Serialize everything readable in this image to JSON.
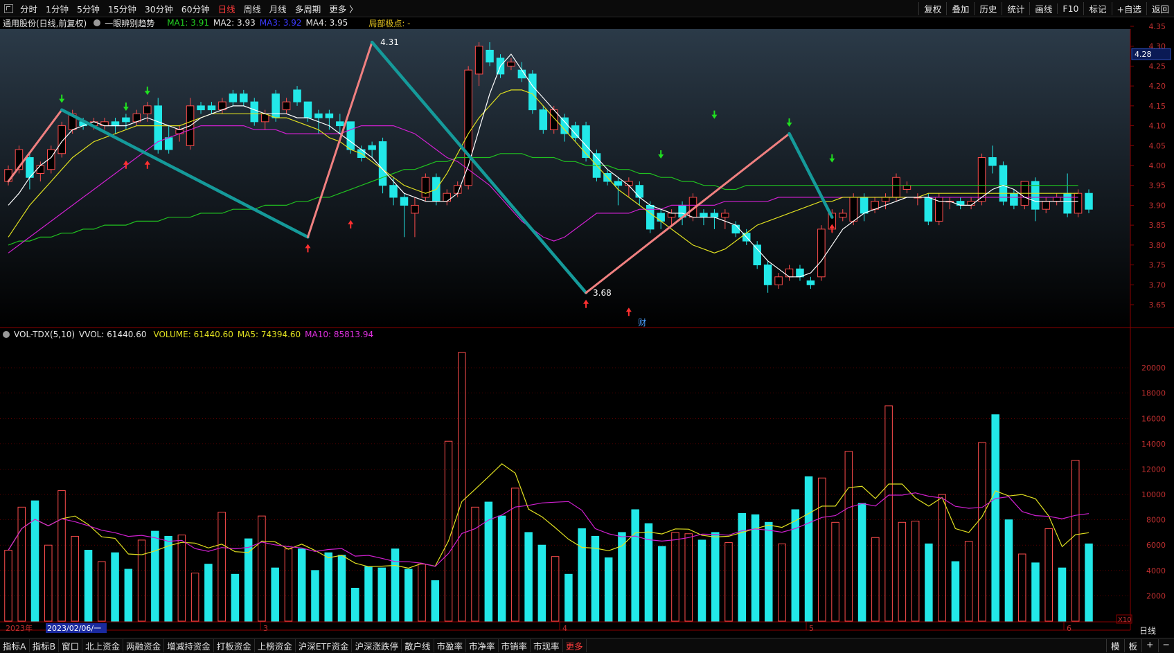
{
  "toolbar": {
    "periods": [
      "分时",
      "1分钟",
      "5分钟",
      "15分钟",
      "30分钟",
      "60分钟",
      "日线",
      "周线",
      "月线",
      "多周期",
      "更多 〉"
    ],
    "active_period": "日线",
    "right_tools": [
      "复权",
      "叠加",
      "历史",
      "统计",
      "画线",
      "F10",
      "标记",
      "+自选",
      "返回"
    ]
  },
  "info": {
    "title": "通用股份(日线,前复权)",
    "indicator": "一眼辨别趋势",
    "ma1": "MA1: 3.91",
    "ma2": "MA2: 3.93",
    "ma3": "MA3: 3.92",
    "ma4": "MA4: 3.95",
    "pivot": "局部极点: -"
  },
  "vol_info": {
    "name": "VOL-TDX(5,10)",
    "vvol": "VVOL: 61440.60",
    "volume": "VOLUME: 61440.60",
    "ma5": "MA5: 74394.60",
    "ma10": "MA10: 85813.94"
  },
  "bottom": {
    "tabs": [
      "指标A",
      "指标B",
      "窗口",
      "北上资金",
      "两融资金",
      "增减持资金",
      "打板资金",
      "上榜资金",
      "沪深ETF资金",
      "沪深涨跌停",
      "散户线",
      "市盈率",
      "市净率",
      "市销率",
      "市现率",
      "更多"
    ],
    "right": [
      "模",
      "板",
      "+",
      "−"
    ],
    "period_label": "日线"
  },
  "colors": {
    "up": "#ff4d4d",
    "down": "#22e8e8",
    "ma1": "#ffffff",
    "ma2": "#e0e020",
    "ma3": "#d020d0",
    "ma4": "#20c020",
    "zig_up": "#f08080",
    "zig_down": "#159a9a",
    "grid": "#8b0000"
  },
  "chart_data": {
    "type": "candlestick",
    "price_axis": {
      "ticks": [
        "4.35",
        "4.30",
        "4.25",
        "4.20",
        "4.15",
        "4.10",
        "4.05",
        "4.00",
        "3.95",
        "3.90",
        "3.85",
        "3.80",
        "3.75",
        "3.70",
        "3.65"
      ],
      "last": "4.28"
    },
    "volume_axis": {
      "ticks": [
        "20000",
        "18000",
        "16000",
        "14000",
        "12000",
        "10000",
        "8000",
        "6000",
        "4000",
        "2000"
      ],
      "unit": "X10"
    },
    "x_labels": [
      "2023年",
      "2023/02/06/一",
      "3",
      "4",
      "5",
      "6"
    ],
    "annotations": {
      "high": "4.31",
      "low": "3.68",
      "event": "财"
    },
    "candles": [
      [
        3.96,
        3.99,
        3.95,
        4.0
      ],
      [
        3.99,
        4.04,
        3.98,
        4.05
      ],
      [
        4.02,
        3.97,
        3.94,
        4.03
      ],
      [
        3.98,
        4.0,
        3.96,
        4.01
      ],
      [
        3.99,
        4.04,
        3.98,
        4.05
      ],
      [
        4.03,
        4.1,
        4.02,
        4.11
      ],
      [
        4.09,
        4.13,
        4.08,
        4.14
      ],
      [
        4.11,
        4.1,
        4.09,
        4.12
      ],
      [
        4.1,
        4.11,
        4.09,
        4.12
      ],
      [
        4.1,
        4.11,
        4.09,
        4.12
      ],
      [
        4.11,
        4.1,
        4.08,
        4.12
      ],
      [
        4.12,
        4.11,
        4.09,
        4.13
      ],
      [
        4.11,
        4.13,
        4.1,
        4.14
      ],
      [
        4.13,
        4.15,
        4.11,
        4.16
      ],
      [
        4.15,
        4.04,
        4.03,
        4.17
      ],
      [
        4.07,
        4.04,
        4.03,
        4.1
      ],
      [
        4.08,
        4.09,
        4.06,
        4.1
      ],
      [
        4.05,
        4.15,
        4.04,
        4.17
      ],
      [
        4.15,
        4.14,
        4.13,
        4.16
      ],
      [
        4.15,
        4.14,
        4.13,
        4.16
      ],
      [
        4.14,
        4.16,
        4.13,
        4.17
      ],
      [
        4.18,
        4.16,
        4.15,
        4.19
      ],
      [
        4.18,
        4.16,
        4.15,
        4.19
      ],
      [
        4.16,
        4.11,
        4.1,
        4.17
      ],
      [
        4.11,
        4.13,
        4.09,
        4.14
      ],
      [
        4.18,
        4.12,
        4.11,
        4.19
      ],
      [
        4.14,
        4.16,
        4.13,
        4.17
      ],
      [
        4.19,
        4.16,
        4.15,
        4.2
      ],
      [
        4.16,
        4.12,
        4.11,
        4.16
      ],
      [
        4.13,
        4.12,
        4.08,
        4.14
      ],
      [
        4.13,
        4.12,
        4.09,
        4.14
      ],
      [
        4.11,
        4.1,
        4.08,
        4.13
      ],
      [
        4.11,
        4.04,
        4.03,
        4.11
      ],
      [
        4.04,
        4.02,
        4.01,
        4.05
      ],
      [
        4.05,
        4.04,
        4.02,
        4.06
      ],
      [
        4.06,
        3.95,
        3.93,
        4.07
      ],
      [
        3.95,
        3.92,
        3.9,
        3.97
      ],
      [
        3.92,
        3.9,
        3.82,
        3.93
      ],
      [
        3.88,
        3.9,
        3.82,
        3.92
      ],
      [
        3.92,
        3.97,
        3.91,
        3.98
      ],
      [
        3.97,
        3.91,
        3.9,
        3.98
      ],
      [
        3.91,
        3.93,
        3.9,
        3.94
      ],
      [
        3.93,
        3.95,
        3.92,
        3.96
      ],
      [
        3.95,
        4.24,
        3.94,
        4.25
      ],
      [
        4.23,
        4.3,
        4.2,
        4.31
      ],
      [
        4.29,
        4.26,
        4.25,
        4.31
      ],
      [
        4.27,
        4.23,
        4.22,
        4.28
      ],
      [
        4.25,
        4.26,
        4.24,
        4.27
      ],
      [
        4.24,
        4.22,
        4.21,
        4.26
      ],
      [
        4.23,
        4.14,
        4.13,
        4.24
      ],
      [
        4.14,
        4.09,
        4.08,
        4.15
      ],
      [
        4.09,
        4.14,
        4.08,
        4.15
      ],
      [
        4.12,
        4.08,
        4.06,
        4.13
      ],
      [
        4.1,
        4.07,
        4.06,
        4.11
      ],
      [
        4.1,
        4.02,
        4.01,
        4.11
      ],
      [
        4.03,
        3.97,
        3.96,
        4.04
      ],
      [
        3.98,
        3.96,
        3.95,
        3.99
      ],
      [
        3.96,
        3.95,
        3.9,
        3.97
      ],
      [
        3.95,
        3.96,
        3.92,
        3.97
      ],
      [
        3.95,
        3.92,
        3.9,
        3.96
      ],
      [
        3.9,
        3.84,
        3.83,
        3.91
      ],
      [
        3.88,
        3.86,
        3.84,
        3.89
      ],
      [
        3.87,
        3.88,
        3.85,
        3.89
      ],
      [
        3.9,
        3.87,
        3.85,
        3.91
      ],
      [
        3.87,
        3.92,
        3.86,
        3.93
      ],
      [
        3.88,
        3.87,
        3.85,
        3.89
      ],
      [
        3.88,
        3.87,
        3.84,
        3.89
      ],
      [
        3.87,
        3.88,
        3.84,
        3.89
      ],
      [
        3.85,
        3.83,
        3.82,
        3.86
      ],
      [
        3.83,
        3.81,
        3.8,
        3.84
      ],
      [
        3.8,
        3.75,
        3.74,
        3.81
      ],
      [
        3.75,
        3.7,
        3.68,
        3.76
      ],
      [
        3.7,
        3.72,
        3.69,
        3.73
      ],
      [
        3.72,
        3.74,
        3.71,
        3.75
      ],
      [
        3.74,
        3.72,
        3.71,
        3.75
      ],
      [
        3.71,
        3.7,
        3.69,
        3.72
      ],
      [
        3.72,
        3.84,
        3.71,
        3.85
      ],
      [
        3.84,
        3.88,
        3.83,
        3.89
      ],
      [
        3.87,
        3.88,
        3.86,
        3.89
      ],
      [
        3.86,
        3.92,
        3.85,
        3.93
      ],
      [
        3.92,
        3.88,
        3.86,
        3.93
      ],
      [
        3.89,
        3.91,
        3.88,
        3.92
      ],
      [
        3.91,
        3.92,
        3.89,
        3.93
      ],
      [
        3.92,
        3.97,
        3.91,
        3.98
      ],
      [
        3.94,
        3.95,
        3.93,
        3.96
      ],
      [
        3.92,
        3.92,
        3.9,
        3.93
      ],
      [
        3.92,
        3.86,
        3.85,
        3.93
      ],
      [
        3.86,
        3.92,
        3.85,
        3.93
      ],
      [
        3.91,
        3.91,
        3.89,
        3.92
      ],
      [
        3.91,
        3.9,
        3.89,
        3.92
      ],
      [
        3.9,
        3.91,
        3.89,
        3.92
      ],
      [
        3.91,
        4.02,
        3.9,
        4.03
      ],
      [
        4.02,
        4.0,
        3.98,
        4.05
      ],
      [
        4.0,
        3.91,
        3.9,
        4.01
      ],
      [
        3.93,
        3.9,
        3.89,
        3.94
      ],
      [
        3.9,
        3.96,
        3.89,
        3.96
      ],
      [
        3.96,
        3.89,
        3.86,
        3.97
      ],
      [
        3.89,
        3.91,
        3.88,
        3.92
      ],
      [
        3.91,
        3.92,
        3.9,
        3.93
      ],
      [
        3.93,
        3.88,
        3.87,
        3.98
      ],
      [
        3.88,
        3.93,
        3.87,
        3.94
      ],
      [
        3.93,
        3.89,
        3.88,
        3.94
      ]
    ],
    "volumes": [
      5600,
      9000,
      9500,
      6000,
      10300,
      6700,
      5600,
      4700,
      5400,
      4100,
      6400,
      7100,
      6700,
      6800,
      3800,
      4500,
      8600,
      3700,
      6500,
      8300,
      4200,
      5700,
      5700,
      4000,
      5400,
      5200,
      2600,
      4300,
      4200,
      5700,
      4100,
      4500,
      3200,
      14200,
      21200,
      9000,
      9400,
      8300,
      10500,
      7000,
      6000,
      5100,
      3700,
      7300,
      6700,
      5000,
      7000,
      8800,
      7700,
      5900,
      7000,
      6900,
      6400,
      7000,
      6200,
      8500,
      8400,
      7800,
      6100,
      8800,
      11400,
      11300,
      7800,
      13400,
      9300,
      6600,
      17000,
      7800,
      7900,
      6100,
      10000,
      4700,
      6300,
      14100,
      16300,
      8000,
      5300,
      4600,
      7300,
      4200,
      12700,
      6100
    ],
    "ma1": [
      3.9,
      3.93,
      3.97,
      4.0,
      4.02,
      4.06,
      4.09,
      4.1,
      4.11,
      4.1,
      4.1,
      4.1,
      4.11,
      4.12,
      4.11,
      4.1,
      4.09,
      4.1,
      4.12,
      4.13,
      4.14,
      4.15,
      4.15,
      4.14,
      4.13,
      4.13,
      4.13,
      4.12,
      4.12,
      4.11,
      4.1,
      4.08,
      4.06,
      4.04,
      4.02,
      3.99,
      3.96,
      3.93,
      3.92,
      3.91,
      3.91,
      3.91,
      3.93,
      4.0,
      4.09,
      4.18,
      4.25,
      4.28,
      4.24,
      4.2,
      4.17,
      4.14,
      4.11,
      4.08,
      4.05,
      4.02,
      3.99,
      3.97,
      3.95,
      3.92,
      3.9,
      3.89,
      3.88,
      3.88,
      3.87,
      3.87,
      3.87,
      3.86,
      3.85,
      3.82,
      3.79,
      3.76,
      3.74,
      3.72,
      3.72,
      3.73,
      3.76,
      3.8,
      3.84,
      3.86,
      3.88,
      3.89,
      3.9,
      3.91,
      3.92,
      3.92,
      3.92,
      3.91,
      3.91,
      3.9,
      3.9,
      3.92,
      3.94,
      3.95,
      3.94,
      3.92,
      3.91,
      3.91,
      3.91,
      3.91,
      3.91
    ],
    "ma2": [
      3.82,
      3.86,
      3.9,
      3.93,
      3.96,
      3.99,
      4.02,
      4.04,
      4.06,
      4.07,
      4.08,
      4.09,
      4.1,
      4.1,
      4.1,
      4.1,
      4.1,
      4.11,
      4.12,
      4.13,
      4.13,
      4.13,
      4.13,
      4.13,
      4.13,
      4.12,
      4.12,
      4.11,
      4.1,
      4.09,
      4.07,
      4.06,
      4.04,
      4.03,
      4.01,
      3.99,
      3.97,
      3.95,
      3.94,
      3.93,
      3.94,
      3.98,
      4.03,
      4.08,
      4.12,
      4.15,
      4.18,
      4.19,
      4.19,
      4.18,
      4.15,
      4.12,
      4.09,
      4.06,
      4.03,
      4.0,
      3.97,
      3.94,
      3.92,
      3.9,
      3.88,
      3.86,
      3.84,
      3.82,
      3.8,
      3.79,
      3.78,
      3.79,
      3.81,
      3.83,
      3.85,
      3.86,
      3.87,
      3.88,
      3.89,
      3.9,
      3.91,
      3.91,
      3.92,
      3.92,
      3.92,
      3.92,
      3.92,
      3.92,
      3.92,
      3.92,
      3.93,
      3.93,
      3.93,
      3.93,
      3.93,
      3.93,
      3.93,
      3.93,
      3.93,
      3.93,
      3.93,
      3.93,
      3.93,
      3.93,
      3.93
    ],
    "ma3": [
      3.78,
      3.8,
      3.82,
      3.84,
      3.86,
      3.88,
      3.9,
      3.92,
      3.94,
      3.96,
      3.98,
      4.0,
      4.02,
      4.04,
      4.06,
      4.07,
      4.08,
      4.09,
      4.1,
      4.1,
      4.1,
      4.1,
      4.1,
      4.09,
      4.09,
      4.09,
      4.08,
      4.08,
      4.08,
      4.08,
      4.08,
      4.08,
      4.09,
      4.1,
      4.1,
      4.1,
      4.1,
      4.09,
      4.08,
      4.06,
      4.04,
      4.02,
      4.01,
      3.99,
      3.97,
      3.95,
      3.92,
      3.89,
      3.86,
      3.84,
      3.82,
      3.81,
      3.82,
      3.84,
      3.86,
      3.88,
      3.88,
      3.88,
      3.88,
      3.89,
      3.89,
      3.89,
      3.9,
      3.9,
      3.9,
      3.9,
      3.9,
      3.91,
      3.91,
      3.91,
      3.91,
      3.91,
      3.92,
      3.92,
      3.92,
      3.92,
      3.92,
      3.92,
      3.92,
      3.92,
      3.92,
      3.92,
      3.92,
      3.92,
      3.92,
      3.92,
      3.92,
      3.92,
      3.92,
      3.92,
      3.92,
      3.92,
      3.92,
      3.92,
      3.92,
      3.92,
      3.92,
      3.92,
      3.92,
      3.92,
      3.92
    ],
    "ma4": [
      3.8,
      3.81,
      3.81,
      3.82,
      3.82,
      3.83,
      3.83,
      3.84,
      3.84,
      3.85,
      3.85,
      3.85,
      3.86,
      3.86,
      3.86,
      3.87,
      3.87,
      3.87,
      3.88,
      3.88,
      3.88,
      3.89,
      3.89,
      3.89,
      3.9,
      3.9,
      3.9,
      3.91,
      3.91,
      3.92,
      3.92,
      3.93,
      3.94,
      3.95,
      3.96,
      3.97,
      3.98,
      3.99,
      3.99,
      4.0,
      4.01,
      4.01,
      4.02,
      4.02,
      4.02,
      4.02,
      4.03,
      4.03,
      4.03,
      4.02,
      4.02,
      4.02,
      4.01,
      4.01,
      4.0,
      4.0,
      4.0,
      3.99,
      3.99,
      3.98,
      3.98,
      3.97,
      3.97,
      3.96,
      3.96,
      3.95,
      3.95,
      3.94,
      3.94,
      3.95,
      3.95,
      3.95,
      3.95,
      3.95,
      3.95,
      3.95,
      3.95,
      3.95,
      3.95,
      3.95,
      3.95,
      3.95,
      3.95,
      3.95,
      3.95,
      3.95,
      3.95,
      3.95,
      3.95,
      3.95,
      3.95,
      3.95,
      3.95,
      3.95,
      3.95,
      3.95,
      3.95,
      3.95,
      3.95,
      3.95,
      3.95
    ],
    "zigzag": [
      [
        0,
        3.96
      ],
      [
        5,
        4.14
      ],
      [
        28,
        3.82
      ],
      [
        34,
        4.31
      ],
      [
        54,
        3.68
      ],
      [
        73,
        4.08
      ],
      [
        77,
        3.87
      ]
    ]
  }
}
